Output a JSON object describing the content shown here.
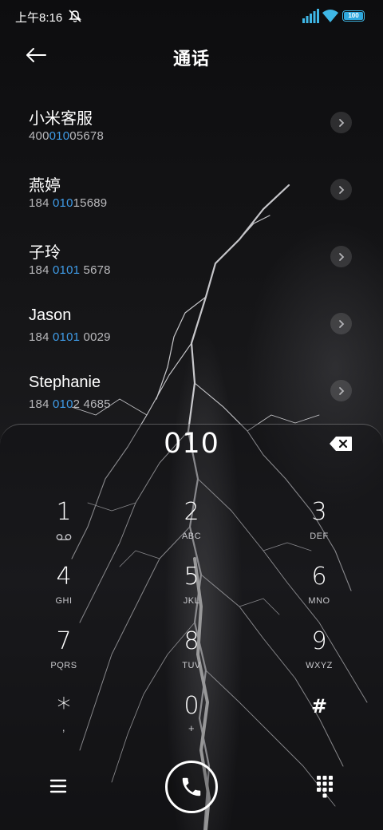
{
  "status_bar": {
    "time": "上午8:16",
    "battery": "100"
  },
  "header": {
    "title": "通话"
  },
  "contacts": [
    {
      "name": "小米客服",
      "num_pre": "400",
      "num_hl": "010",
      "num_post": "05678"
    },
    {
      "name": "燕婷",
      "num_pre": "184 ",
      "num_hl": "010",
      "num_post": "15689"
    },
    {
      "name": "子玲",
      "num_pre": "184 ",
      "num_hl": "0101",
      "num_post": " 5678"
    },
    {
      "name": "Jason",
      "num_pre": "184 ",
      "num_hl": "0101",
      "num_post": " 0029"
    },
    {
      "name": "Stephanie",
      "num_pre": "184 ",
      "num_hl": "010",
      "num_post": "2 4685"
    }
  ],
  "dialpad": {
    "input": "010",
    "keys": [
      {
        "digit": "1",
        "sub": ""
      },
      {
        "digit": "2",
        "sub": "ABC"
      },
      {
        "digit": "3",
        "sub": "DEF"
      },
      {
        "digit": "4",
        "sub": "GHI"
      },
      {
        "digit": "5",
        "sub": "JKL"
      },
      {
        "digit": "6",
        "sub": "MNO"
      },
      {
        "digit": "7",
        "sub": "PQRS"
      },
      {
        "digit": "8",
        "sub": "TUV"
      },
      {
        "digit": "9",
        "sub": "WXYZ"
      },
      {
        "digit": "*",
        "sub": ","
      },
      {
        "digit": "0",
        "sub": "+"
      },
      {
        "digit": "#",
        "sub": ""
      }
    ]
  },
  "colors": {
    "highlight": "#3f9ce8",
    "battery": "#2fa8de",
    "signal": "#3fb7e6"
  },
  "icons": [
    "back-arrow-icon",
    "chevron-right-icon",
    "backspace-icon",
    "voicemail-icon",
    "menu-icon",
    "phone-icon",
    "keypad-icon",
    "signal-icon",
    "wifi-icon",
    "battery-icon",
    "mute-icon"
  ]
}
